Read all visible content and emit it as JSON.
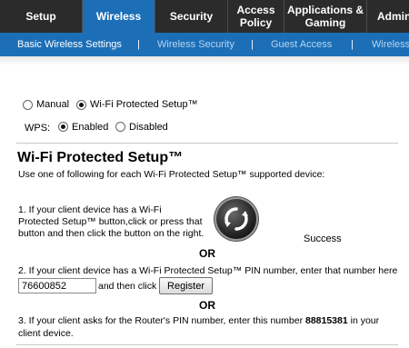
{
  "top_nav": {
    "tabs": [
      {
        "label": "Setup"
      },
      {
        "label": "Wireless"
      },
      {
        "label": "Security"
      },
      {
        "label": "Access Policy"
      },
      {
        "label": "Applications & Gaming"
      },
      {
        "label": "Admin"
      }
    ],
    "active": "Wireless"
  },
  "sub_nav": {
    "items": [
      {
        "label": "Basic Wireless Settings"
      },
      {
        "label": "Wireless Security"
      },
      {
        "label": "Guest Access"
      },
      {
        "label": "Wireless"
      }
    ],
    "separator": "|",
    "active": "Basic Wireless Settings"
  },
  "config_mode": {
    "options": [
      {
        "label": "Manual",
        "selected": false
      },
      {
        "label": "Wi-Fi Protected Setup™",
        "selected": true
      }
    ]
  },
  "wps": {
    "label": "WPS:",
    "options": [
      {
        "label": "Enabled",
        "selected": true
      },
      {
        "label": "Disabled",
        "selected": false
      }
    ]
  },
  "section": {
    "title": "Wi-Fi Protected Setup™",
    "intro": "Use one of following for each Wi-Fi Protected Setup™ supported device:",
    "method1": {
      "lines": [
        "1. If your client device has a Wi-Fi",
        "Protected Setup™ button,click or press that",
        "button and then click the button on the right."
      ],
      "status": "Success"
    },
    "or_label": "OR",
    "method2": {
      "text": "2. If your client device has a Wi-Fi Protected Setup™ PIN number, enter that number here",
      "pin_value": "76600852",
      "then_click": "and then click",
      "register_label": "Register"
    },
    "method3": {
      "prefix": "3. If your client asks for the Router's PIN number, enter this number ",
      "router_pin": "88815381",
      "suffix": " in your",
      "line2": "client device."
    }
  },
  "colors": {
    "nav_dark": "#2b2b2b",
    "accent_blue": "#1c6fb7",
    "subnav_inactive": "#b7d4f0"
  }
}
